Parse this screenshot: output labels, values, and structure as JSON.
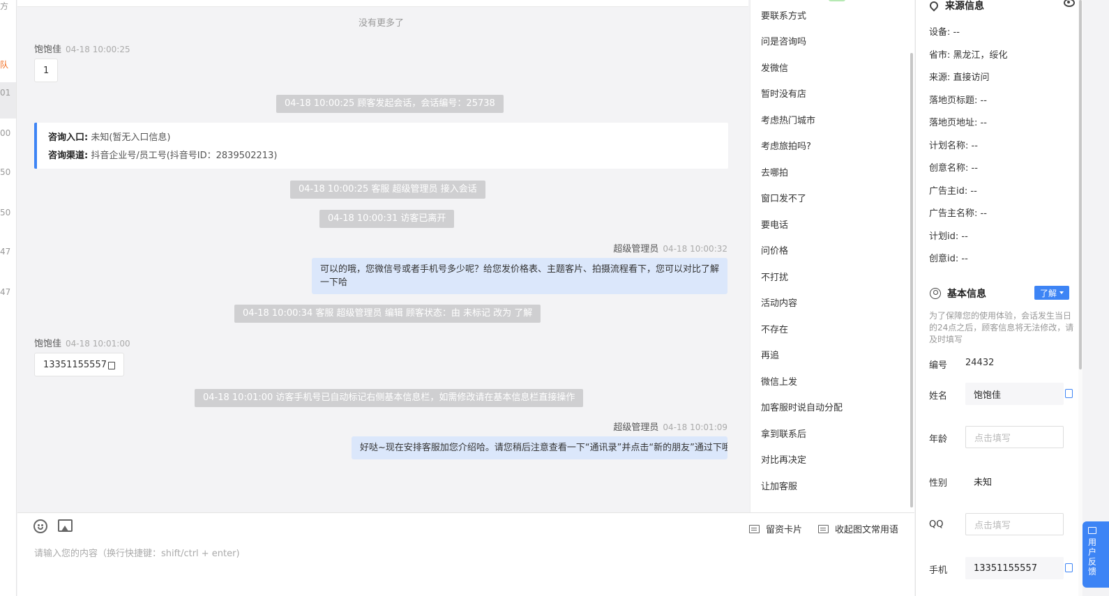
{
  "left_list": {
    "items": [
      {
        "text": "方"
      },
      {
        "text": "队"
      },
      {
        "text": "01"
      },
      {
        "text": "00"
      },
      {
        "text": "50"
      },
      {
        "text": "50"
      },
      {
        "text": "47"
      },
      {
        "text": "47"
      }
    ]
  },
  "chat": {
    "no_more": "没有更多了",
    "visitor_name": "饱饱佳",
    "agent_name": "超级管理员",
    "messages": {
      "m1_time": "04-18 10:00:25",
      "m1_text": "1",
      "sys1": "04-18 10:00:25 顾客发起会话，会话编号：25738",
      "card_entry_label": "咨询入口:",
      "card_entry_value": "未知(暂无入口信息)",
      "card_channel_label": "咨询渠道:",
      "card_channel_value": "抖音企业号/员工号(抖音号ID：2839502213)",
      "sys2": "04-18 10:00:25 客服 超级管理员 接入会话",
      "sys3": "04-18 10:00:31 访客已离开",
      "m2_time": "04-18 10:00:32",
      "m2_text": "可以的哦，您微信号或者手机号多少呢？给您发价格表、主题客片、拍摄流程看下，您可以对比了解一下哈",
      "sys4": "04-18 10:00:34 客服 超级管理员 编辑 顾客状态：由 未标记 改为 了解",
      "m3_time": "04-18 10:01:00",
      "m3_text": "13351155557",
      "sys5": "04-18 10:01:00 访客手机号已自动标记右侧基本信息栏，如需修改请在基本信息栏直接操作",
      "m4_time": "04-18 10:01:09",
      "m4_text": "好哒~现在安排客服加您介绍哈。请您稍后注意查看一下“通讯录”并点击“新的朋友”通过下哦"
    }
  },
  "composer": {
    "placeholder": "请输入您的内容（换行快捷键：shift/ctrl + enter)",
    "card_btn": "留资卡片",
    "collapse_btn": "收起图文常用语",
    "icons": [
      "emoji-icon",
      "image-icon"
    ]
  },
  "quick_replies": [
    "要联系方式",
    "问是咨询吗",
    "发微信",
    "暂时没有店",
    "考虑热门城市",
    "考虑旅拍吗?",
    "去哪拍",
    "窗口发不了",
    "要电话",
    "问价格",
    "不打扰",
    "活动内容",
    "不存在",
    "再追",
    "微信上发",
    "加客服时说自动分配",
    "拿到联系后",
    "对比再决定",
    "让加客服"
  ],
  "source_info": {
    "title": "来源信息",
    "rows": [
      {
        "label": "设备:",
        "value": "--"
      },
      {
        "label": "省市:",
        "value": "黑龙江，绥化"
      },
      {
        "label": "来源:",
        "value": "直接访问"
      },
      {
        "label": "落地页标题:",
        "value": "--"
      },
      {
        "label": "落地页地址:",
        "value": "--"
      },
      {
        "label": "计划名称:",
        "value": "--"
      },
      {
        "label": "创意名称:",
        "value": "--"
      },
      {
        "label": "广告主id:",
        "value": "--"
      },
      {
        "label": "广告主名称:",
        "value": "--"
      },
      {
        "label": "计划id:",
        "value": "--"
      },
      {
        "label": "创意id:",
        "value": "--"
      }
    ]
  },
  "basic_info": {
    "title": "基本信息",
    "status_tag": "了解",
    "notice": "为了保障您的使用体验，会话发生当日的24点之后，顾客信息将无法修改，请及时填写",
    "id_label": "编号",
    "id_value": "24432",
    "name_label": "姓名",
    "name_value": "饱饱佳",
    "age_label": "年龄",
    "age_placeholder": "点击填写",
    "gender_label": "性别",
    "gender_value": "未知",
    "qq_label": "QQ",
    "qq_placeholder": "点击填写",
    "phone_label": "手机",
    "phone_value": "13351155557"
  },
  "feedback": {
    "l1": "用",
    "l2": "户",
    "l3": "反",
    "l4": "馈"
  },
  "colors": {
    "accent": "#3d84f5",
    "agent_bubble": "#dbe7fb",
    "system_pill": "#cfcfd1",
    "orange": "#f26b1d"
  }
}
